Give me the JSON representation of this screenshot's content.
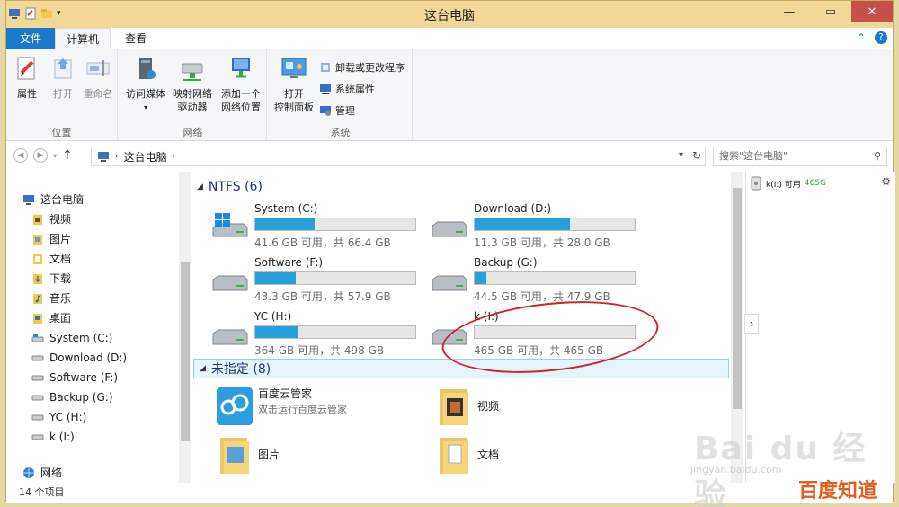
{
  "window": {
    "title": "这台电脑"
  },
  "ribbon_tabs": [
    {
      "label": "文件"
    },
    {
      "label": "计算机"
    },
    {
      "label": "查看"
    }
  ],
  "ribbon": {
    "location_group": {
      "name": "位置",
      "properties": "属性",
      "open": "打开",
      "rename": "重命名"
    },
    "network_group": {
      "name": "网络",
      "access_media": "访问媒体",
      "map_drive_1": "映射网络",
      "map_drive_2": "驱动器",
      "add_location_1": "添加一个",
      "add_location_2": "网络位置"
    },
    "system_group": {
      "name": "系统",
      "open_cp_1": "打开",
      "open_cp_2": "控制面板",
      "uninstall": "卸载或更改程序",
      "sys_props": "系统属性",
      "manage": "管理"
    }
  },
  "address": {
    "path": "这台电脑"
  },
  "search": {
    "placeholder": "搜索\"这台电脑\""
  },
  "nav_pane": {
    "items": [
      {
        "label": "这台电脑",
        "icon": "computer-icon"
      },
      {
        "label": "视频",
        "icon": "videos-folder-icon"
      },
      {
        "label": "图片",
        "icon": "pictures-folder-icon"
      },
      {
        "label": "文档",
        "icon": "documents-folder-icon"
      },
      {
        "label": "下载",
        "icon": "downloads-folder-icon"
      },
      {
        "label": "音乐",
        "icon": "music-folder-icon"
      },
      {
        "label": "桌面",
        "icon": "desktop-folder-icon"
      },
      {
        "label": "System (C:)",
        "icon": "system-drive-icon"
      },
      {
        "label": "Download (D:)",
        "icon": "drive-icon"
      },
      {
        "label": "Software (F:)",
        "icon": "drive-icon"
      },
      {
        "label": "Backup (G:)",
        "icon": "drive-icon"
      },
      {
        "label": "YC (H:)",
        "icon": "drive-icon"
      },
      {
        "label": "k (I:)",
        "icon": "drive-icon"
      },
      {
        "label": "网络",
        "icon": "network-icon"
      }
    ]
  },
  "sections": {
    "ntfs": "NTFS (6)",
    "unspecified": "未指定 (8)"
  },
  "drives": [
    {
      "name": "System (C:)",
      "info": "41.6 GB 可用，共 66.4 GB",
      "used_fraction": 0.373
    },
    {
      "name": "Download (D:)",
      "info": "11.3 GB 可用，共 28.0 GB",
      "used_fraction": 0.596
    },
    {
      "name": "Software (F:)",
      "info": "43.3 GB 可用，共 57.9 GB",
      "used_fraction": 0.252
    },
    {
      "name": "Backup (G:)",
      "info": "44.5 GB 可用，共 47.9 GB",
      "used_fraction": 0.071
    },
    {
      "name": "YC (H:)",
      "info": "364 GB 可用，共 498 GB",
      "used_fraction": 0.269
    },
    {
      "name": "k (I:)",
      "info": "465 GB 可用，共 465 GB",
      "used_fraction": 0.0
    }
  ],
  "unspecified_items": [
    {
      "name": "百度云管家",
      "sub": "双击运行百度云管家"
    },
    {
      "name": "视频",
      "sub": ""
    },
    {
      "name": "图片",
      "sub": ""
    },
    {
      "name": "文档",
      "sub": ""
    }
  ],
  "details": {
    "label": "k(I:) 可用",
    "free": "465G"
  },
  "status": {
    "count": "14 个项目"
  },
  "watermark": {
    "brand": "Bai du 经验",
    "url": "jingyan.baidu.com",
    "logo": "百度知道"
  },
  "colors": {
    "accent": "#1979ca",
    "bar_fill": "#26a0da",
    "annotation": "#c9272f"
  }
}
